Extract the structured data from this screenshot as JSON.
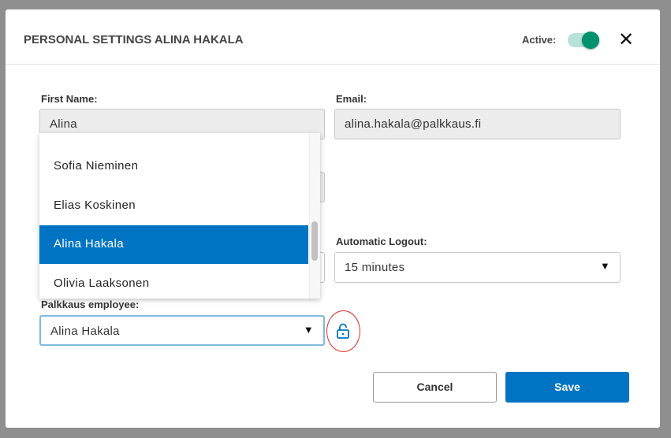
{
  "modal": {
    "title": "PERSONAL SETTINGS ALINA HAKALA",
    "active_label": "Active:",
    "active": true,
    "close_icon": "close-icon"
  },
  "form": {
    "first_name": {
      "label": "First Name:",
      "value": "Alina"
    },
    "email": {
      "label": "Email:",
      "value": "alina.hakala@palkkaus.fi"
    },
    "automatic_logout": {
      "label": "Automatic Logout:",
      "value": "15 minutes"
    },
    "palkkaus_employee": {
      "label": "Palkkaus employee:",
      "value": "Alina Hakala",
      "options": [
        "Sofia Nieminen",
        "Elias Koskinen",
        "Alina Hakala",
        "Olivia Laaksonen"
      ],
      "selected": "Alina Hakala"
    },
    "lock_icon": "unlock-icon"
  },
  "buttons": {
    "cancel": "Cancel",
    "save": "Save"
  },
  "colors": {
    "accent": "#0074c2",
    "toggle": "#009270",
    "highlight": "#e0302a"
  }
}
